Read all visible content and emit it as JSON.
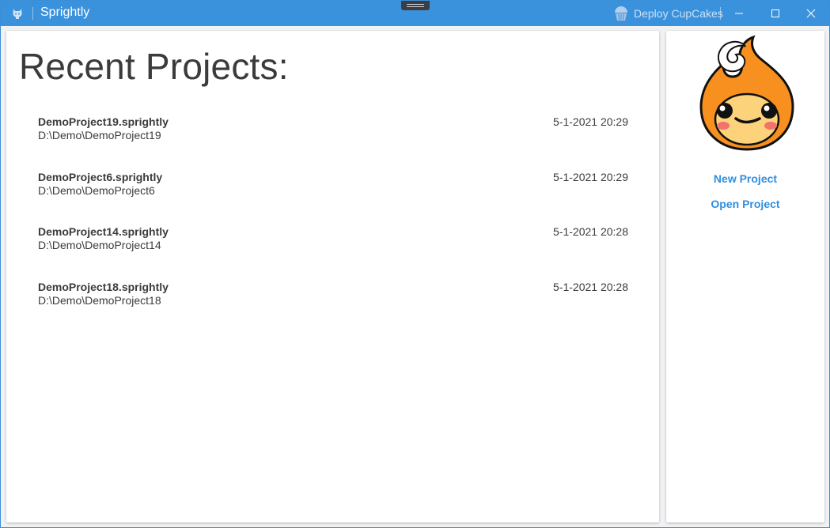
{
  "window": {
    "title": "Sprightly",
    "accent_color": "#3a92dd",
    "app_icon": "github-octocat-icon",
    "deploy_label": "Deploy CupCakes",
    "deploy_icon": "cupcake-icon",
    "controls": {
      "minimize_icon": "minimize-icon",
      "maximize_icon": "maximize-icon",
      "close_icon": "close-icon"
    }
  },
  "main": {
    "heading": "Recent Projects:",
    "projects": [
      {
        "name": "DemoProject19.sprightly",
        "path": "D:\\Demo\\DemoProject19",
        "date": "5-1-2021 20:29"
      },
      {
        "name": "DemoProject6.sprightly",
        "path": "D:\\Demo\\DemoProject6",
        "date": "5-1-2021 20:29"
      },
      {
        "name": "DemoProject14.sprightly",
        "path": "D:\\Demo\\DemoProject14",
        "date": "5-1-2021 20:28"
      },
      {
        "name": "DemoProject18.sprightly",
        "path": "D:\\Demo\\DemoProject18",
        "date": "5-1-2021 20:28"
      }
    ]
  },
  "sidebar": {
    "mascot_icon": "flame-mascot-icon",
    "new_project_label": "New Project",
    "open_project_label": "Open Project",
    "link_color": "#2f8ee0"
  }
}
